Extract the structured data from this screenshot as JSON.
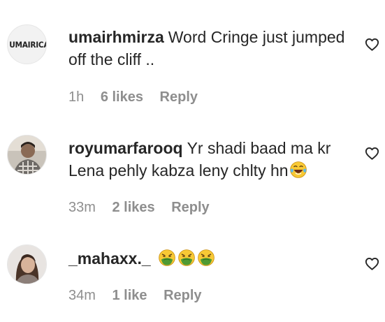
{
  "comments": [
    {
      "avatar_text": "UMAIRICA",
      "username": "umairhmirza",
      "text": "Word Cringe just jumped off the cliff ..",
      "time": "1h",
      "likes": "6 likes",
      "reply": "Reply",
      "emojis": []
    },
    {
      "username": "royumarfarooq",
      "text": "Yr shadi baad ma kr Lena pehly kabza leny chlty hn",
      "time": "33m",
      "likes": "2 likes",
      "reply": "Reply",
      "emojis": [
        "face-with-tears-of-joy"
      ]
    },
    {
      "username": "_mahaxx._",
      "text": "",
      "time": "34m",
      "likes": "1 like",
      "reply": "Reply",
      "emojis": [
        "nauseated-face",
        "nauseated-face",
        "nauseated-face"
      ]
    }
  ],
  "icons": {
    "like": "heart-outline-icon"
  },
  "colors": {
    "text": "#262626",
    "meta": "#8e8e8e"
  }
}
